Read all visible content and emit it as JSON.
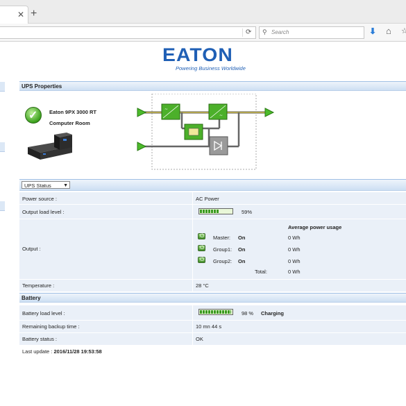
{
  "browser": {
    "tab_close": "✕",
    "tab_new": "+",
    "search_placeholder": "Search"
  },
  "brand": {
    "logo": "EATON",
    "tagline": "Powering Business Worldwide",
    "color": "#1f5fb5"
  },
  "ups_properties": {
    "header": "UPS Properties",
    "model": "Eaton 9PX 3000 RT",
    "location": "Computer Room"
  },
  "ups_status": {
    "dropdown_value": "UPS Status",
    "power_source_label": "Power source :",
    "power_source_value": "AC Power",
    "output_load_label": "Output load level :",
    "output_load_value": "59%",
    "output_load_fraction": 0.59,
    "output_label": "Output :",
    "avg_power_header": "Average power usage",
    "outputs": [
      {
        "name": "Master:",
        "state": "On",
        "power": "0 Wh"
      },
      {
        "name": "Group1:",
        "state": "On",
        "power": "0 Wh"
      },
      {
        "name": "Group2:",
        "state": "On",
        "power": "0 Wh"
      }
    ],
    "total_label": "Total:",
    "total_value": "0 Wh",
    "temperature_label": "Temperature :",
    "temperature_value": "28 °C"
  },
  "battery": {
    "header": "Battery",
    "load_label": "Battery load level :",
    "load_value": "98 %",
    "load_fraction": 0.98,
    "charging": "Charging",
    "backup_label": "Remaining backup time :",
    "backup_value": "10 mn 44 s",
    "status_label": "Battery status :",
    "status_value": "OK"
  },
  "last_update": {
    "label": "Last update : ",
    "value": "2016/11/28 19:53:58"
  }
}
